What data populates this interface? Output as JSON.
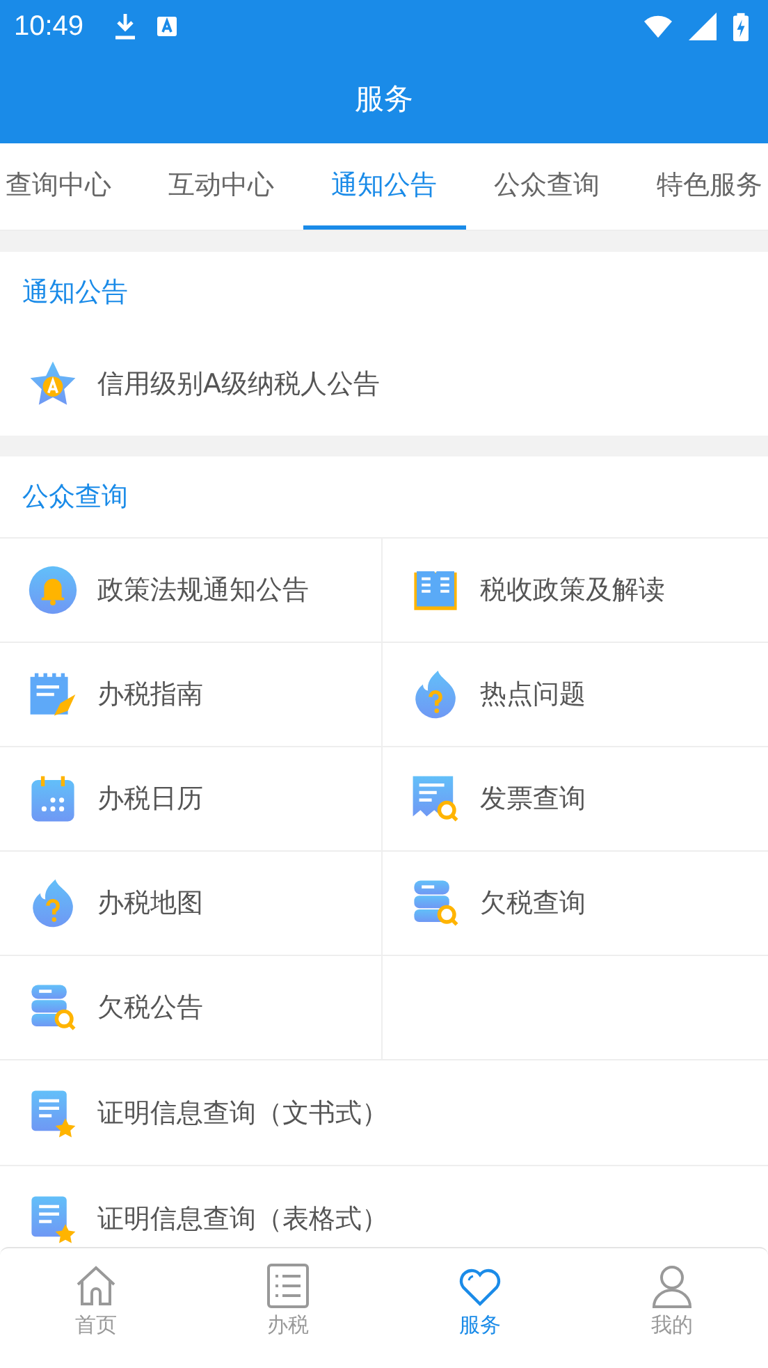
{
  "status_bar": {
    "time": "10:49"
  },
  "title": "服务",
  "tabs": [
    {
      "label": "查询中心",
      "selected": false
    },
    {
      "label": "互动中心",
      "selected": false
    },
    {
      "label": "通知公告",
      "selected": true
    },
    {
      "label": "公众查询",
      "selected": false
    },
    {
      "label": "特色服务",
      "selected": false
    }
  ],
  "notice_section": {
    "title": "通知公告",
    "items": [
      {
        "label": "信用级别A级纳税人公告"
      }
    ]
  },
  "public_section": {
    "title": "公众查询",
    "grid_items": [
      {
        "label": "政策法规通知公告"
      },
      {
        "label": "税收政策及解读"
      },
      {
        "label": "办税指南"
      },
      {
        "label": "热点问题"
      },
      {
        "label": "办税日历"
      },
      {
        "label": "发票查询"
      },
      {
        "label": "办税地图"
      },
      {
        "label": "欠税查询"
      },
      {
        "label": "欠税公告"
      }
    ],
    "list_items": [
      {
        "label": "证明信息查询（文书式）"
      },
      {
        "label": "证明信息查询（表格式）"
      }
    ]
  },
  "bottom_nav": [
    {
      "label": "首页",
      "selected": false
    },
    {
      "label": "办税",
      "selected": false
    },
    {
      "label": "服务",
      "selected": true
    },
    {
      "label": "我的",
      "selected": false
    }
  ]
}
